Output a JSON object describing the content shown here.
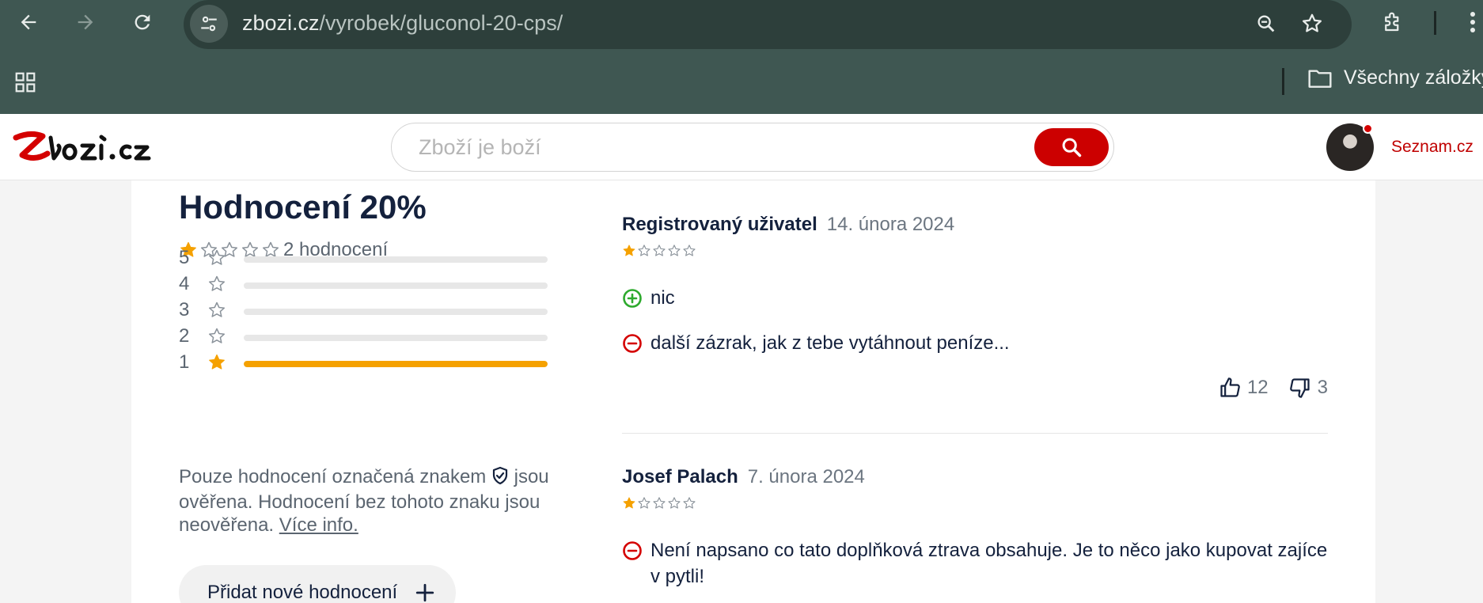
{
  "browser": {
    "url_host": "zbozi.cz",
    "url_path": "/vyrobek/gluconol-20-cps/",
    "bookmarks_folder": "Všechny záložky"
  },
  "site": {
    "logo_text": "Zboží.cz",
    "search_placeholder": "Zboží je boží",
    "seznam_link": "Seznam.cz"
  },
  "summary": {
    "title": "Hodnocení 20%",
    "stars": 1,
    "count_text": "2 hodnocení",
    "distribution": [
      {
        "stars": "5",
        "share": 0
      },
      {
        "stars": "4",
        "share": 0
      },
      {
        "stars": "3",
        "share": 0
      },
      {
        "stars": "2",
        "share": 0
      },
      {
        "stars": "1",
        "share": 1
      }
    ],
    "info_before": "Pouze hodnocení označená znakem",
    "info_after": "jsou ověřena. Hodnocení bez tohoto znaku jsou neověřena.",
    "info_link": "Více info.",
    "add_button": "Přidat nové hodnocení"
  },
  "reviews": [
    {
      "author": "Registrovaný uživatel",
      "date": "14. února 2024",
      "stars": 1,
      "pros": "nic",
      "cons": "další zázrak, jak z tebe vytáhnout peníze...",
      "likes": "12",
      "dislikes": "3"
    },
    {
      "author": "Josef Palach",
      "date": "7. února 2024",
      "stars": 1,
      "cons": "Není napsano co tato doplňková ztrava obsahuje. Je to něco jako kupovat zajíce v pytli!"
    }
  ],
  "colors": {
    "chrome": "#3f5752",
    "brand_red": "#cc0000",
    "star": "#f5a100",
    "pro_green": "#2eaa2e",
    "con_red": "#d40000"
  }
}
